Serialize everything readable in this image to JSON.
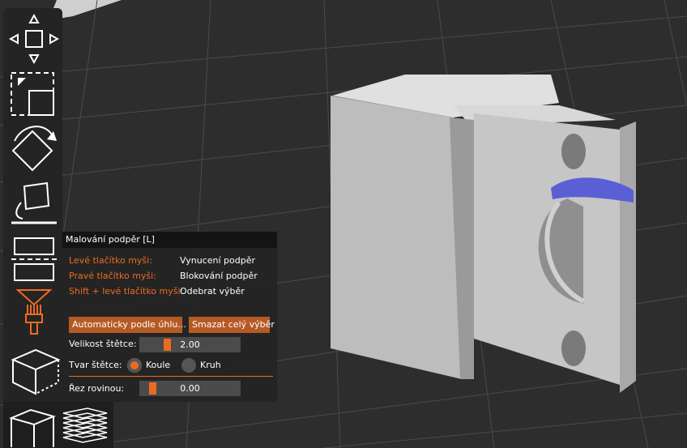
{
  "panel": {
    "title": "Malování podpěr [L]",
    "shortcuts": [
      {
        "key": "Levé tlačítko myši:",
        "action": "Vynucení podpěr"
      },
      {
        "key": "Pravé tlačítko myši:",
        "action": "Blokování podpěr"
      },
      {
        "key": "Shift + levé tlačítko myši:",
        "action": "Odebrat výběr"
      }
    ],
    "auto_button": "Automaticky podle úhlu...",
    "clear_button": "Smazat celý výběr",
    "brush_size": {
      "label": "Velikost štětce:",
      "value": "2.00",
      "fraction": 0.2
    },
    "brush_shape": {
      "label": "Tvar štětce:",
      "options": [
        "Koule",
        "Kruh"
      ],
      "selected": "Koule"
    },
    "plane_cut": {
      "label": "Řez rovinou:",
      "value": "0.00",
      "fraction": 0.0
    }
  },
  "colors": {
    "accent": "#ed6b21",
    "paint": "#5a5fd6",
    "model": "#bdbdbd",
    "bed": "#2d2d2d"
  },
  "toolbar_icons": [
    "move-icon",
    "scale-icon",
    "rotate-icon",
    "place-on-face-icon",
    "cut-icon",
    "support-paint-icon",
    "3d-view-icon",
    "layers-icon"
  ]
}
